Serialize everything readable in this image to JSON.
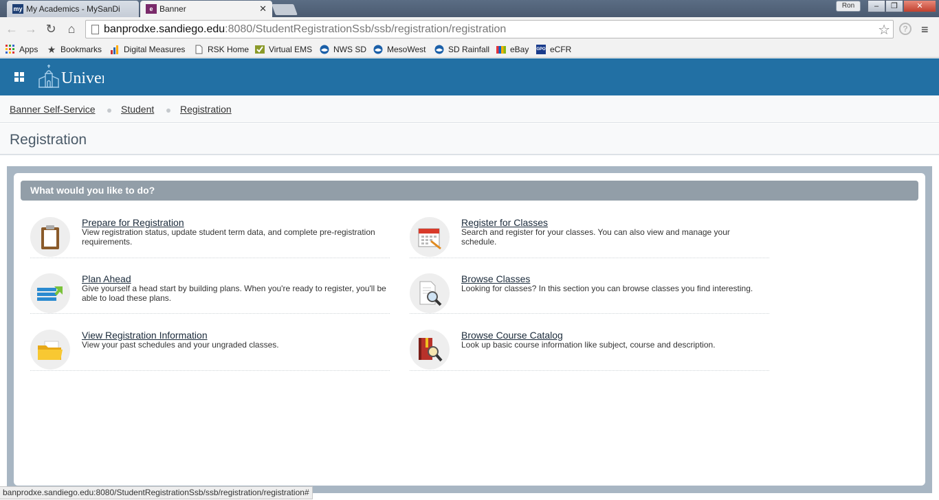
{
  "browser": {
    "tabs": [
      {
        "favicon": "my",
        "label": "My Academics - MySanDi",
        "close": ""
      },
      {
        "favicon": "e",
        "label": "Banner",
        "close": "✕"
      }
    ],
    "profile": "Ron",
    "window_buttons": {
      "minimize": "–",
      "maximize": "❐",
      "close": "✕"
    },
    "url": {
      "host": "banprodxe.sandiego.edu",
      "path": ":8080/StudentRegistrationSsb/ssb/registration/registration"
    },
    "bookmarks": [
      {
        "label": "Apps",
        "icon": "apps-icon"
      },
      {
        "label": "Bookmarks",
        "icon": "star-icon"
      },
      {
        "label": "Digital Measures",
        "icon": "digital-measures-icon"
      },
      {
        "label": "RSK Home",
        "icon": "page-icon"
      },
      {
        "label": "Virtual EMS",
        "icon": "virtual-ems-icon"
      },
      {
        "label": "NWS SD",
        "icon": "noaa-icon"
      },
      {
        "label": "MesoWest",
        "icon": "noaa-icon"
      },
      {
        "label": "SD Rainfall",
        "icon": "noaa-icon"
      },
      {
        "label": "eBay",
        "icon": "ebay-icon"
      },
      {
        "label": "eCFR",
        "icon": "gpo-icon"
      }
    ],
    "gpo_label": "GPO",
    "status_url": "banprodxe.sandiego.edu:8080/StudentRegistrationSsb/ssb/registration/registration#"
  },
  "header": {
    "logo_text": "University of San Diego"
  },
  "breadcrumb": [
    "Banner Self-Service",
    "Student",
    "Registration"
  ],
  "page_title": "Registration",
  "panel": {
    "heading": "What would you like to do?",
    "tasks": [
      {
        "title": "Prepare for Registration",
        "desc": "View registration status, update student term data, and complete pre-registration requirements.",
        "icon": "clipboard-icon"
      },
      {
        "title": "Register for Classes",
        "desc": "Search and register for your classes. You can also view and manage your schedule.",
        "icon": "calendar-icon"
      },
      {
        "title": "Plan Ahead",
        "desc": "Give yourself a head start by building plans. When you're ready to register, you'll be able to load these plans.",
        "icon": "plan-list-icon"
      },
      {
        "title": "Browse Classes",
        "desc": "Looking for classes? In this section you can browse classes you find interesting.",
        "icon": "document-search-icon"
      },
      {
        "title": "View Registration Information",
        "desc": "View your past schedules and your ungraded classes.",
        "icon": "folder-icon"
      },
      {
        "title": "Browse Course Catalog",
        "desc": "Look up basic course information like subject, course and description.",
        "icon": "book-search-icon"
      }
    ]
  }
}
